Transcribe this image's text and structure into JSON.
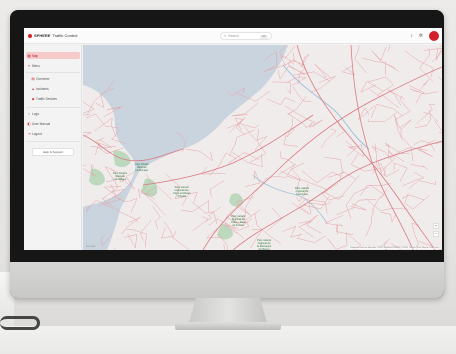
{
  "app": {
    "brand_strong": "SPHERE",
    "brand_rest": "Traffic Control"
  },
  "search": {
    "placeholder": "Search",
    "shortcut": "⌘K"
  },
  "topbar": {
    "icons": [
      "bell-icon",
      "gear-icon"
    ]
  },
  "sidebar": {
    "items": [
      {
        "label": "Map",
        "icon": "map-icon",
        "active": true
      },
      {
        "label": "Menu",
        "icon": "menu-icon",
        "active": false
      },
      {
        "label": "Overview",
        "icon": "overview-icon",
        "active": false,
        "sub": true
      },
      {
        "label": "Incidents",
        "icon": "incident-icon",
        "active": false,
        "sub": true
      },
      {
        "label": "Traffic Devices",
        "icon": "device-icon",
        "active": false,
        "sub": true
      },
      {
        "label": "Logs",
        "icon": "logs-icon",
        "active": false
      },
      {
        "label": "User Manual",
        "icon": "manual-icon",
        "active": false
      },
      {
        "label": "Logout",
        "icon": "logout-icon",
        "active": false
      }
    ],
    "help_button": "Help & Support"
  },
  "map": {
    "labels": [
      {
        "text": "Kent Downs\nNational\nLandscape"
      },
      {
        "text": "High Weald\nNational\nLandscape"
      },
      {
        "text": "Parc naturel\nrégional des\nCaps et Marais\nd'Opale"
      },
      {
        "text": "Parc naturel\nrégional de\nl'Avesnois"
      },
      {
        "text": "Parc naturel\nrégional de\nl'Oise - Pays\nde France"
      },
      {
        "text": "Parc naturel\nrégional de\nla Montagne\nde Reims"
      }
    ],
    "google": "Google",
    "attribution": "Keyboard shortcuts  Map data ©2024 GeoBasis-DE/BKG (©2009), Google  Terms  Report a map error"
  },
  "colors": {
    "accent": "#d3202a",
    "active_bg": "#f6c9cb",
    "sea": "#c9d4df",
    "road": "#e8a6aa",
    "park": "#bcd9bd"
  }
}
